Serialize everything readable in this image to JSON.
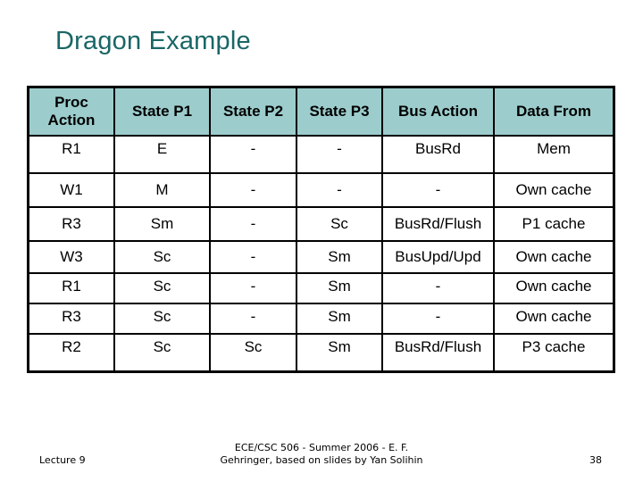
{
  "slide": {
    "title": "Dragon Example"
  },
  "table": {
    "headers": [
      "Proc Action",
      "State P1",
      "State P2",
      "State P3",
      "Bus Action",
      "Data From"
    ],
    "header_lines": {
      "proc_line1": "Proc",
      "proc_line2": "Action"
    },
    "rows": [
      [
        "R1",
        "E",
        "-",
        "-",
        "BusRd",
        "Mem"
      ],
      [
        "W1",
        "M",
        "-",
        "-",
        "-",
        "Own cache"
      ],
      [
        "R3",
        "Sm",
        "-",
        "Sc",
        "BusRd/Flush",
        "P1 cache"
      ],
      [
        "W3",
        "Sc",
        "-",
        "Sm",
        "BusUpd/Upd",
        "Own cache"
      ],
      [
        "R1",
        "Sc",
        "-",
        "Sm",
        "-",
        "Own cache"
      ],
      [
        "R3",
        "Sc",
        "-",
        "Sm",
        "-",
        "Own cache"
      ],
      [
        "R2",
        "Sc",
        "Sc",
        "Sm",
        "BusRd/Flush",
        "P3 cache"
      ]
    ],
    "header_bg": "#9ccccc"
  },
  "footer": {
    "left": "Lecture 9",
    "center_line1": "ECE/CSC 506 - Summer 2006 - E. F.",
    "center_line2": "Gehringer, based on slides by Yan Solihin",
    "page_number": "38"
  },
  "colors": {
    "title": "#1a6666"
  }
}
